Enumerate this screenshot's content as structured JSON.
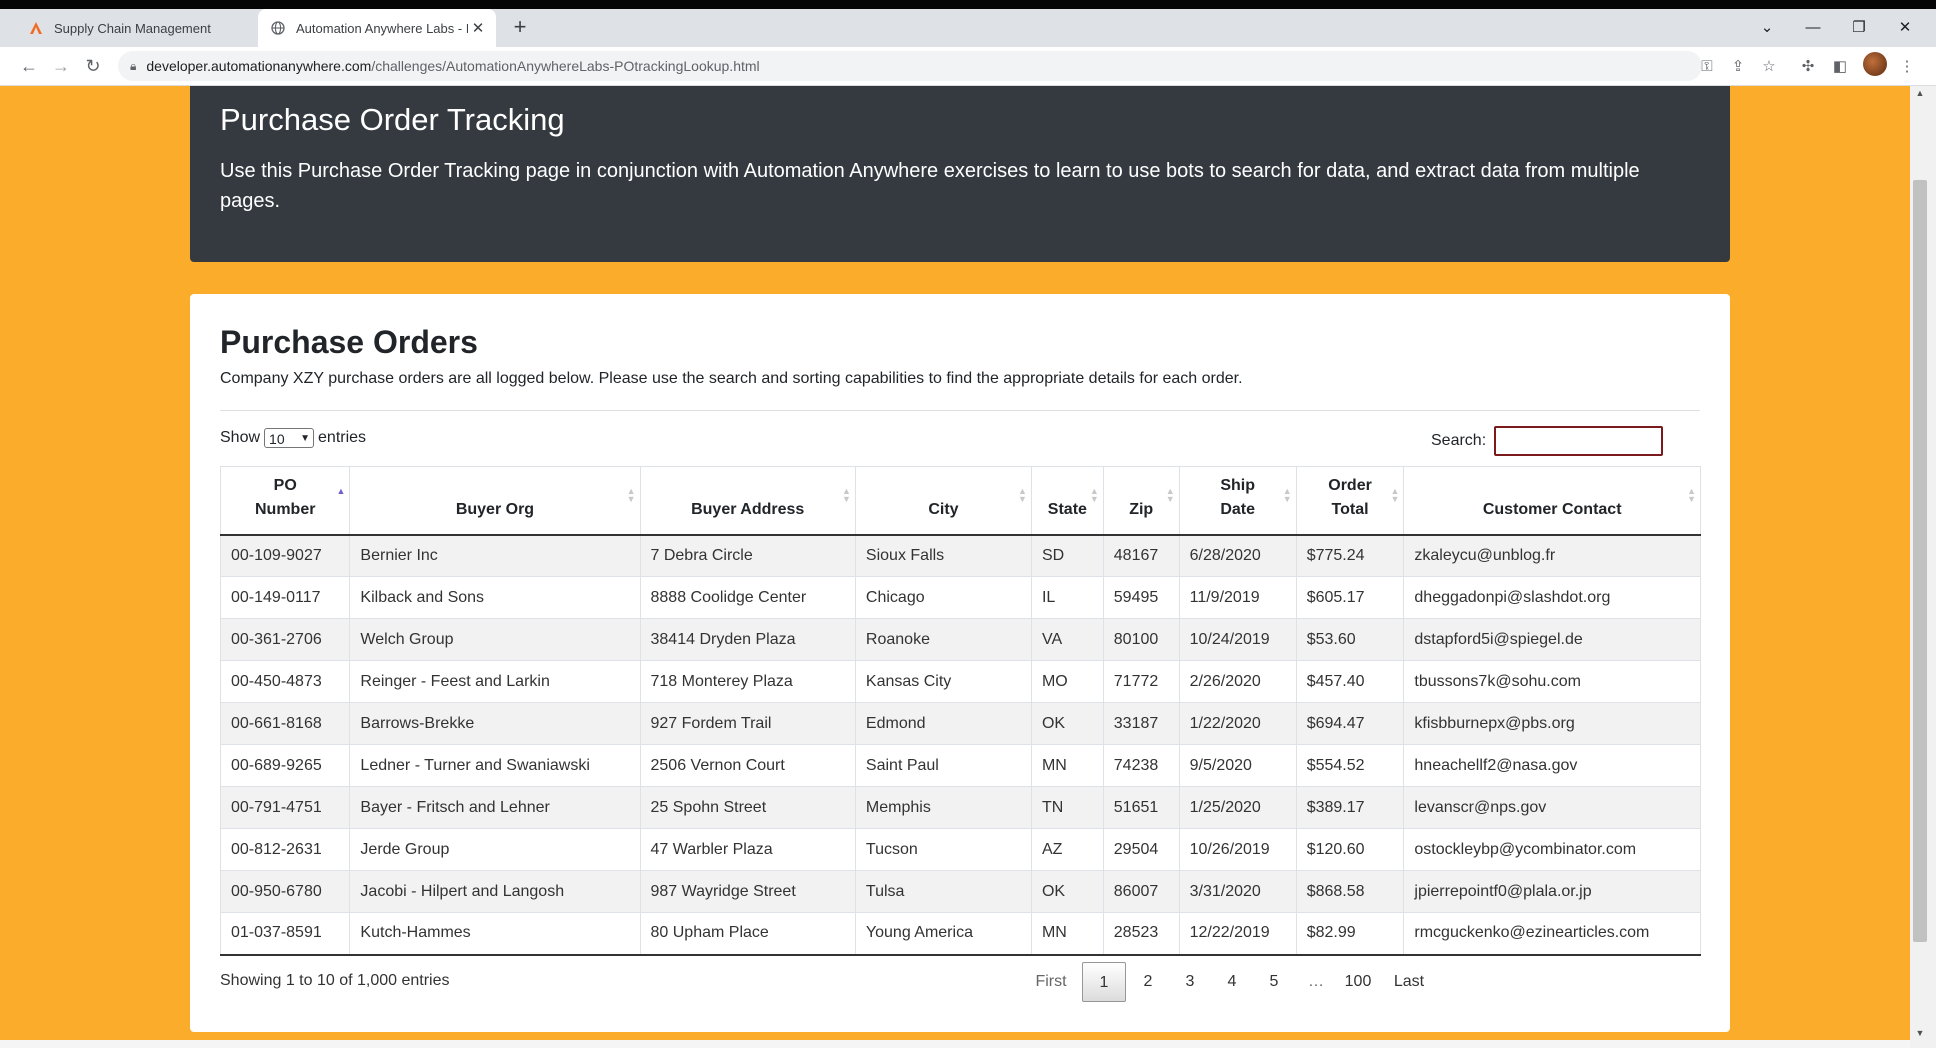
{
  "browser": {
    "tabs": [
      {
        "title": "Supply Chain Management",
        "active": false,
        "favicon": "automation-anywhere-logo-icon"
      },
      {
        "title": "Automation Anywhere Labs - PO",
        "active": true,
        "favicon": "globe-icon"
      }
    ],
    "url_host": "developer.automationanywhere.com",
    "url_path": "/challenges/AutomationAnywhereLabs-POtrackingLookup.html"
  },
  "hero": {
    "title": "Purchase Order Tracking",
    "description": "Use this Purchase Order Tracking page in conjunction with Automation Anywhere exercises to learn to use bots to search for data, and extract data from multiple pages."
  },
  "orders": {
    "heading": "Purchase Orders",
    "lead": "Company XZY purchase orders are all logged below. Please use the search and sorting capabilities to find the appropriate details for each order.",
    "length": {
      "show": "Show",
      "value": "10",
      "entries": "entries"
    },
    "search": {
      "label": "Search:",
      "value": ""
    },
    "columns": [
      {
        "line1": "PO",
        "line2": "Number"
      },
      {
        "line1": "",
        "line2": "Buyer Org"
      },
      {
        "line1": "",
        "line2": "Buyer Address"
      },
      {
        "line1": "",
        "line2": "City"
      },
      {
        "line1": "",
        "line2": "State"
      },
      {
        "line1": "",
        "line2": "Zip"
      },
      {
        "line1": "Ship",
        "line2": "Date"
      },
      {
        "line1": "Order",
        "line2": "Total"
      },
      {
        "line1": "",
        "line2": "Customer Contact"
      }
    ],
    "rows": [
      [
        "00-109-9027",
        "Bernier Inc",
        "7 Debra Circle",
        "Sioux Falls",
        "SD",
        "48167",
        "6/28/2020",
        "$775.24",
        "zkaleycu@unblog.fr"
      ],
      [
        "00-149-0117",
        "Kilback and Sons",
        "8888 Coolidge Center",
        "Chicago",
        "IL",
        "59495",
        "11/9/2019",
        "$605.17",
        "dheggadonpi@slashdot.org"
      ],
      [
        "00-361-2706",
        "Welch Group",
        "38414 Dryden Plaza",
        "Roanoke",
        "VA",
        "80100",
        "10/24/2019",
        "$53.60",
        "dstapford5i@spiegel.de"
      ],
      [
        "00-450-4873",
        "Reinger - Feest and Larkin",
        "718 Monterey Plaza",
        "Kansas City",
        "MO",
        "71772",
        "2/26/2020",
        "$457.40",
        "tbussons7k@sohu.com"
      ],
      [
        "00-661-8168",
        "Barrows-Brekke",
        "927 Fordem Trail",
        "Edmond",
        "OK",
        "33187",
        "1/22/2020",
        "$694.47",
        "kfisbburnepx@pbs.org"
      ],
      [
        "00-689-9265",
        "Ledner - Turner and Swaniawski",
        "2506 Vernon Court",
        "Saint Paul",
        "MN",
        "74238",
        "9/5/2020",
        "$554.52",
        "hneachellf2@nasa.gov"
      ],
      [
        "00-791-4751",
        "Bayer - Fritsch and Lehner",
        "25 Spohn Street",
        "Memphis",
        "TN",
        "51651",
        "1/25/2020",
        "$389.17",
        "levanscr@nps.gov"
      ],
      [
        "00-812-2631",
        "Jerde Group",
        "47 Warbler Plaza",
        "Tucson",
        "AZ",
        "29504",
        "10/26/2019",
        "$120.60",
        "ostockleybp@ycombinator.com"
      ],
      [
        "00-950-6780",
        "Jacobi - Hilpert and Langosh",
        "987 Wayridge Street",
        "Tulsa",
        "OK",
        "86007",
        "3/31/2020",
        "$868.58",
        "jpierrepointf0@plala.or.jp"
      ],
      [
        "01-037-8591",
        "Kutch-Hammes",
        "80 Upham Place",
        "Young America",
        "MN",
        "28523",
        "12/22/2019",
        "$82.99",
        "rmcguckenko@ezinearticles.com"
      ]
    ],
    "info": "Showing 1 to 10 of 1,000 entries",
    "pagination": [
      "First",
      "1",
      "2",
      "3",
      "4",
      "5",
      "…",
      "100",
      "Last"
    ],
    "current_page": "1"
  },
  "colors": {
    "page_bg": "#faac2a",
    "hero_bg": "#343a40",
    "search_border": "#7a1a1a"
  }
}
